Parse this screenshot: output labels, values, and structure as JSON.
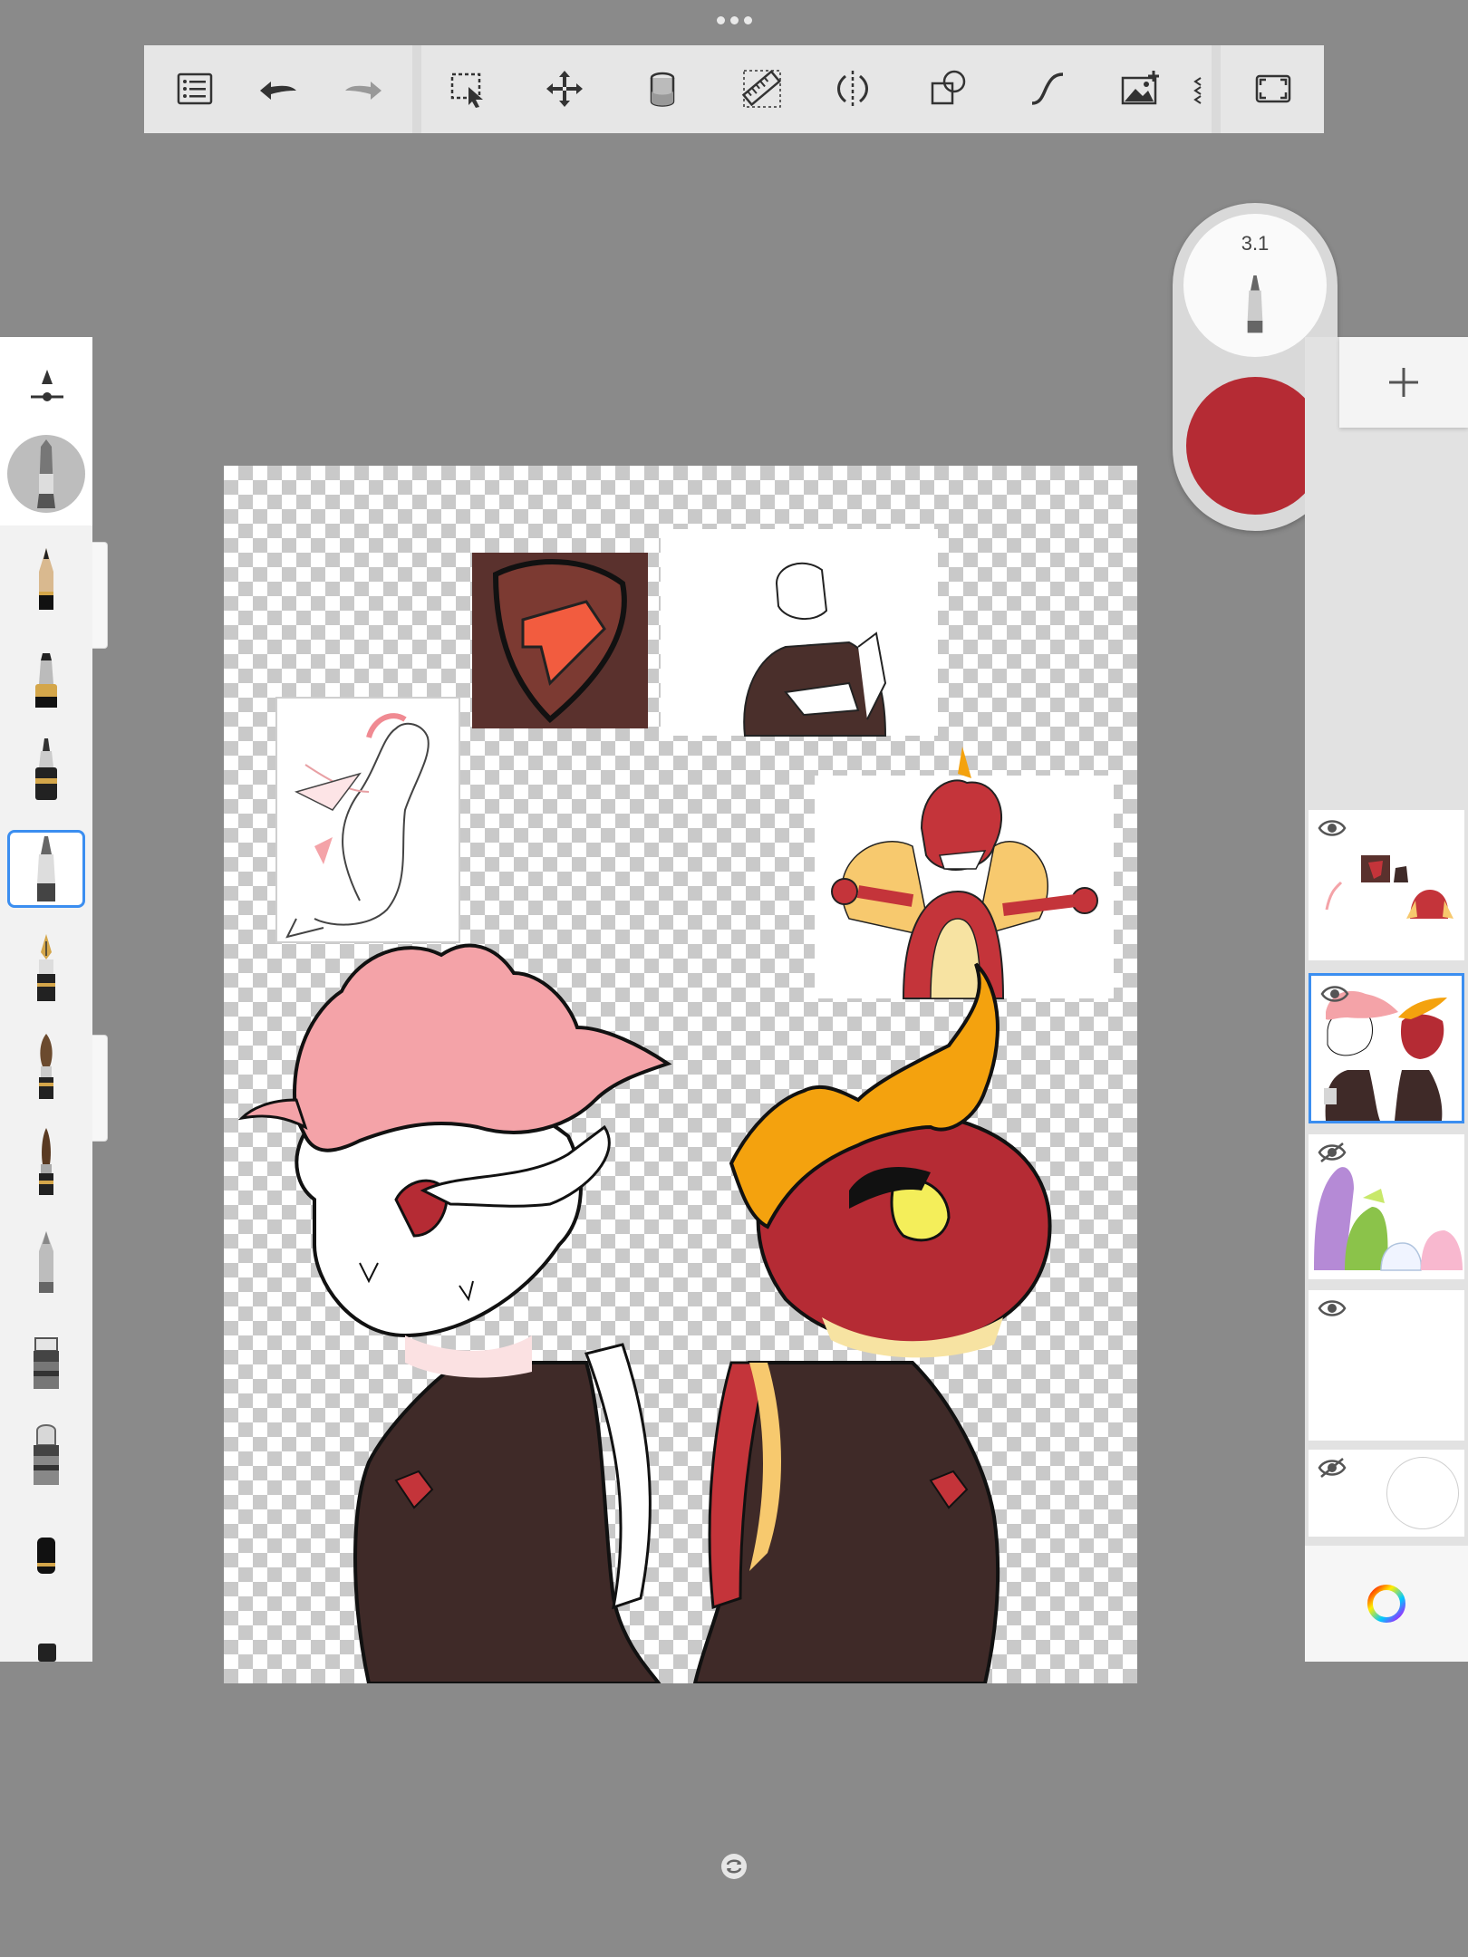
{
  "app": {
    "toolbar": {
      "items": [
        {
          "name": "menu",
          "icon": "list-icon"
        },
        {
          "name": "undo",
          "icon": "undo-arrow-icon"
        },
        {
          "name": "redo",
          "icon": "redo-arrow-icon"
        },
        {
          "name": "selection",
          "icon": "selection-icon"
        },
        {
          "name": "transform",
          "icon": "move-arrows-icon"
        },
        {
          "name": "fill",
          "icon": "paint-bucket-icon"
        },
        {
          "name": "ruler",
          "icon": "ruler-icon"
        },
        {
          "name": "symmetry",
          "icon": "symmetry-icon"
        },
        {
          "name": "shapes",
          "icon": "shapes-icon"
        },
        {
          "name": "stroke",
          "icon": "curve-icon"
        },
        {
          "name": "add-image",
          "icon": "image-add-icon"
        },
        {
          "name": "fullscreen",
          "icon": "fullscreen-icon"
        }
      ]
    },
    "brush_puck": {
      "size_label": "3.1",
      "color": "#b52b34"
    },
    "brushes": [
      {
        "name": "pencil"
      },
      {
        "name": "marker"
      },
      {
        "name": "ink-pen"
      },
      {
        "name": "ballpoint-pen",
        "selected": true
      },
      {
        "name": "fountain-pen"
      },
      {
        "name": "paintbrush"
      },
      {
        "name": "round-brush"
      },
      {
        "name": "airbrush"
      },
      {
        "name": "smudge"
      },
      {
        "name": "eraser"
      },
      {
        "name": "flat-brush"
      }
    ],
    "layers": [
      {
        "name": "layer-references",
        "visible": true,
        "selected": false
      },
      {
        "name": "layer-characters",
        "visible": true,
        "selected": true
      },
      {
        "name": "layer-group-sketch",
        "visible": false,
        "selected": false
      },
      {
        "name": "layer-empty",
        "visible": true,
        "selected": false
      },
      {
        "name": "layer-background",
        "visible": false,
        "selected": false
      }
    ],
    "colors": {
      "accent": "#3b8ef0",
      "current_brush": "#b52b34",
      "pink_hair": "#f4a3a8",
      "red_dragon": "#b52b34",
      "orange_mane": "#f4a20e",
      "coat": "#3f2a28"
    }
  }
}
